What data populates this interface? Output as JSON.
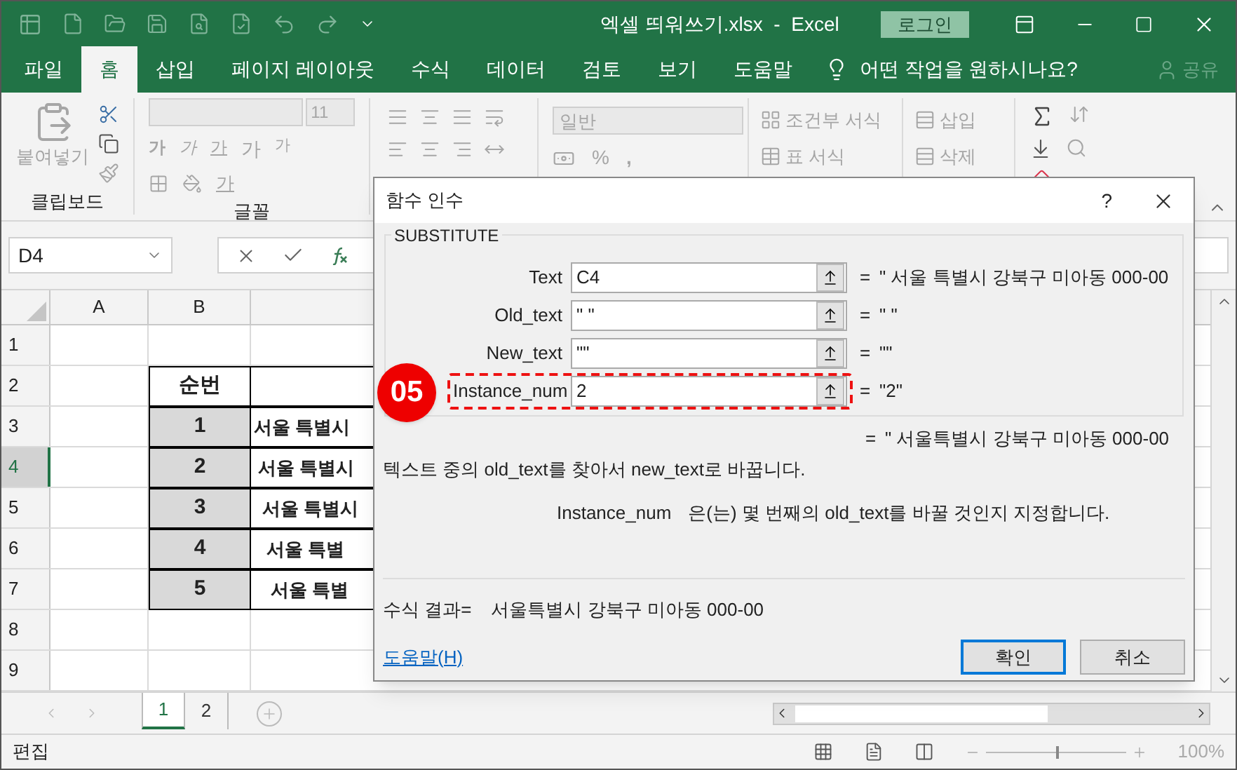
{
  "window": {
    "title": "엑셀 띄워쓰기.xlsx  -  Excel",
    "login_button": "로그인"
  },
  "menu_tabs": [
    {
      "label": "파일",
      "selected": false
    },
    {
      "label": "홈",
      "selected": true
    },
    {
      "label": "삽입",
      "selected": false
    },
    {
      "label": "페이지 레이아웃",
      "selected": false
    },
    {
      "label": "수식",
      "selected": false
    },
    {
      "label": "데이터",
      "selected": false
    },
    {
      "label": "검토",
      "selected": false
    },
    {
      "label": "보기",
      "selected": false
    },
    {
      "label": "도움말",
      "selected": false
    }
  ],
  "tell_me": "어떤 작업을 원하시나요?",
  "share": "공유",
  "ribbon": {
    "paste_label": "붙여넣기",
    "clipboard_label": "클립보드",
    "font_size": "11",
    "font_buttons": [
      {
        "kind": "bold",
        "label": "가"
      },
      {
        "kind": "italic",
        "label": "가"
      },
      {
        "kind": "underline",
        "label": "가"
      },
      {
        "kind": "grow",
        "label": "가"
      },
      {
        "kind": "shrink",
        "label": "가"
      }
    ],
    "font_color": "가",
    "font_label": "글꼴",
    "number_format": "일반",
    "percent": "%",
    "comma": ",",
    "styles": [
      "조건부 서식",
      "표 서식"
    ],
    "cells": [
      "삽입",
      "삭제"
    ]
  },
  "formula_bar": {
    "name_box": "D4"
  },
  "sheet": {
    "columns": [
      "A",
      "B"
    ],
    "rows": [
      {
        "number": "1",
        "selected": false
      },
      {
        "number": "2",
        "selected": false
      },
      {
        "number": "3",
        "selected": false
      },
      {
        "number": "4",
        "selected": true
      },
      {
        "number": "5",
        "selected": false
      },
      {
        "number": "6",
        "selected": false
      },
      {
        "number": "7",
        "selected": false
      },
      {
        "number": "8",
        "selected": false
      },
      {
        "number": "9",
        "selected": false
      }
    ],
    "table": {
      "header": "순번",
      "rows": [
        {
          "index": "1",
          "address": "서울 특별시"
        },
        {
          "index": "2",
          "address": "서울 특별시"
        },
        {
          "index": "3",
          "address": "서울 특별시"
        },
        {
          "index": "4",
          "address": "서울 특별"
        },
        {
          "index": "5",
          "address": "서울 특별"
        }
      ]
    }
  },
  "sheet_tabs": [
    {
      "label": "1",
      "selected": true
    },
    {
      "label": "2",
      "selected": false
    }
  ],
  "status_bar": {
    "mode": "편집",
    "zoom": "100%",
    "zoom_slider": {
      "level": 0.5
    }
  },
  "dialog": {
    "title": "함수 인수",
    "help_mark": "?",
    "function": "SUBSTITUTE",
    "args": [
      {
        "label": "Text",
        "value": "C4",
        "eq": "=",
        "result": "\" 서울 특별시 강북구 미아동 000-00",
        "highlighted": false
      },
      {
        "label": "Old_text",
        "value": "\" \"",
        "eq": "=",
        "result": "\" \"",
        "highlighted": false
      },
      {
        "label": "New_text",
        "value": "\"\"",
        "eq": "=",
        "result": "\"\"",
        "highlighted": false
      },
      {
        "label": "Instance_num",
        "value": "2",
        "eq": "=",
        "result": "\"2\"",
        "highlighted": true
      }
    ],
    "total": {
      "eq": "=",
      "result": "\" 서울특별시 강북구 미아동 000-00"
    },
    "description": "텍스트 중의 old_text를 찾아서 new_text로 바꿉니다.",
    "arg_name": "Instance_num",
    "arg_description": "은(는) 몇 번째의 old_text를 바꿀 것인지 지정합니다.",
    "result_label": "수식 결과=",
    "result_value": "서울특별시 강북구 미아동 000-00",
    "help_link": "도움말(H)",
    "buttons": [
      {
        "label": "확인",
        "default": true
      },
      {
        "label": "취소",
        "default": false
      }
    ]
  },
  "annotation": {
    "step": "05"
  }
}
